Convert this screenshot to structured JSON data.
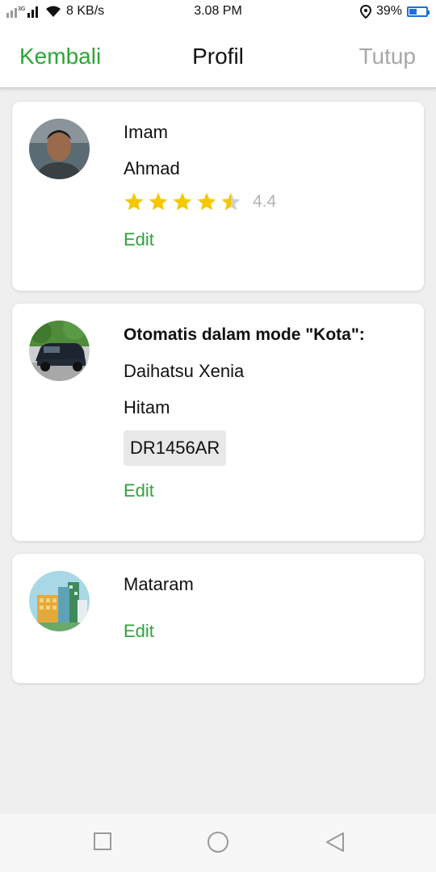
{
  "status_bar": {
    "network_speed": "8 KB/s",
    "time": "3.08 PM",
    "battery": "39%",
    "battery_level": 0.39,
    "signal_label": "3G"
  },
  "header": {
    "back_label": "Kembali",
    "title": "Profil",
    "close_label": "Tutup"
  },
  "profile": {
    "first_name": "Imam",
    "last_name": "Ahmad",
    "rating": 4.4,
    "rating_label": "4.4",
    "edit_label": "Edit"
  },
  "vehicle": {
    "mode_label": "Otomatis dalam mode \"Kota\":",
    "model": "Daihatsu Xenia",
    "color": "Hitam",
    "plate": "DR1456AR",
    "edit_label": "Edit"
  },
  "city": {
    "name": "Mataram",
    "edit_label": "Edit"
  },
  "colors": {
    "accent_green": "#2ea43a",
    "star_yellow": "#f5c800",
    "muted_gray": "#a8a8a8"
  },
  "icons": {
    "nav_recent": "square-icon",
    "nav_home": "circle-icon",
    "nav_back": "triangle-back-icon"
  }
}
